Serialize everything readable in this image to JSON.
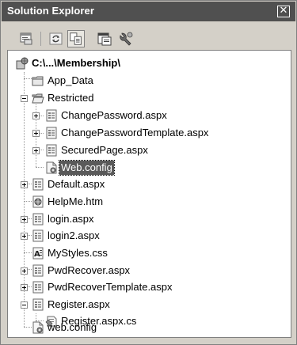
{
  "window": {
    "title": "Solution Explorer",
    "close_glyph": "✕"
  },
  "toolbar": {
    "buttons": [
      {
        "icon": "properties-icon"
      },
      {
        "icon": "refresh-icon"
      },
      {
        "icon": "nest-related-files-icon",
        "pressed": true
      },
      {
        "icon": "view-code-icon"
      },
      {
        "icon": "asp-net-configuration-icon"
      }
    ]
  },
  "tree": {
    "root": {
      "label": "C:\\...\\Membership\\",
      "icon": "web-project-icon"
    },
    "items": [
      {
        "label": "App_Data",
        "icon": "folder-icon",
        "expander": "none"
      },
      {
        "label": "Restricted",
        "icon": "open-folder-icon",
        "expander": "minus"
      },
      {
        "label": "ChangePassword.aspx",
        "icon": "aspx-page-icon",
        "expander": "plus"
      },
      {
        "label": "ChangePasswordTemplate.aspx",
        "icon": "aspx-page-icon",
        "expander": "plus"
      },
      {
        "label": "SecuredPage.aspx",
        "icon": "aspx-page-icon",
        "expander": "plus"
      },
      {
        "label": "Web.config",
        "icon": "config-file-icon",
        "expander": "none",
        "selected": true
      },
      {
        "label": "Default.aspx",
        "icon": "aspx-page-icon",
        "expander": "plus"
      },
      {
        "label": "HelpMe.htm",
        "icon": "html-page-icon",
        "expander": "none"
      },
      {
        "label": "login.aspx",
        "icon": "aspx-page-icon",
        "expander": "plus"
      },
      {
        "label": "login2.aspx",
        "icon": "aspx-page-icon",
        "expander": "plus"
      },
      {
        "label": "MyStyles.css",
        "icon": "stylesheet-icon",
        "expander": "none"
      },
      {
        "label": "PwdRecover.aspx",
        "icon": "aspx-page-icon",
        "expander": "plus"
      },
      {
        "label": "PwdRecoverTemplate.aspx",
        "icon": "aspx-page-icon",
        "expander": "plus"
      },
      {
        "label": "Register.aspx",
        "icon": "aspx-page-icon",
        "expander": "minus"
      },
      {
        "label": "Register.aspx.cs",
        "icon": "csharp-code-file-icon",
        "expander": "none"
      },
      {
        "label": "web.config",
        "icon": "config-file-icon",
        "expander": "none"
      }
    ]
  }
}
